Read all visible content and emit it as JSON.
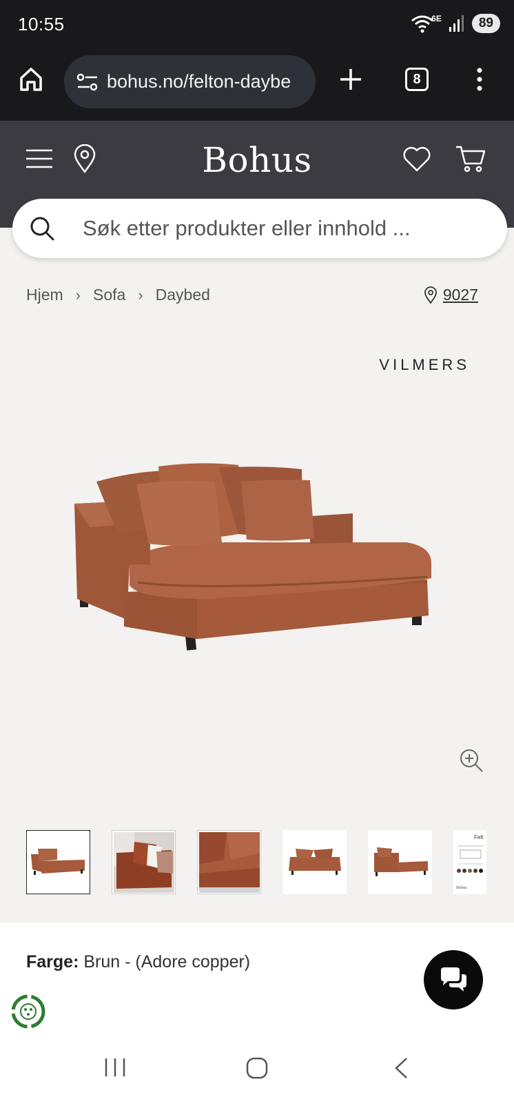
{
  "status_bar": {
    "time": "10:55",
    "network": "6E",
    "battery": "89"
  },
  "browser": {
    "url": "bohus.no/felton-daybe",
    "tab_count": "8"
  },
  "header": {
    "logo": "Bohus"
  },
  "search": {
    "placeholder": "Søk etter produkter eller innhold ..."
  },
  "breadcrumb": {
    "items": [
      "Hjem",
      "Sofa",
      "Daybed"
    ],
    "store_number": "9027"
  },
  "product": {
    "brand": "VILMERS",
    "color_label": "Farge:",
    "color_value": "Brun - (Adore copper)"
  },
  "thumbnails": [
    {
      "name": "thumb-front-angle",
      "selected": true
    },
    {
      "name": "thumb-interior"
    },
    {
      "name": "thumb-closeup"
    },
    {
      "name": "thumb-front"
    },
    {
      "name": "thumb-side"
    },
    {
      "name": "thumb-datasheet",
      "label": "Felt"
    }
  ],
  "colors": {
    "fabric": "#a45a3b",
    "fabric_dark": "#8a4a30",
    "header_bg": "#3b3b41",
    "browser_bg": "#19191b"
  }
}
